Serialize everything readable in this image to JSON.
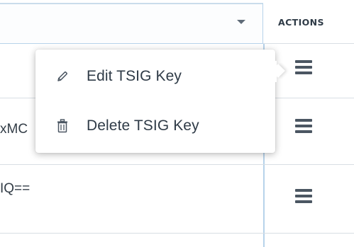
{
  "table": {
    "actions_header": "ACTIONS",
    "rows": [
      {
        "value_fragment": ""
      },
      {
        "value_fragment": "xMC"
      },
      {
        "value_fragment": "IQ=="
      }
    ]
  },
  "action_menu": {
    "items": [
      {
        "label": "Edit TSIG Key",
        "icon": "pencil-icon"
      },
      {
        "label": "Delete TSIG Key",
        "icon": "trash-icon"
      }
    ]
  },
  "colors": {
    "text": "#333d47",
    "accent_border": "#b7d3ea",
    "icon": "#4b5662"
  }
}
